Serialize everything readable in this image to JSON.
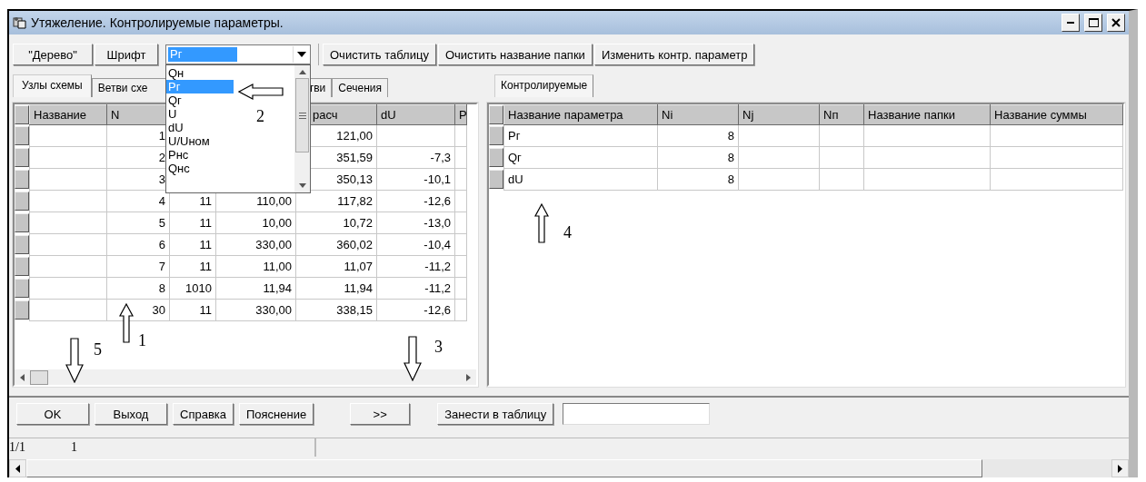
{
  "window": {
    "title": "Утяжеление. Контролируемые параметры."
  },
  "toolbar": {
    "buttons_left": [
      "\"Дерево\"",
      "Шрифт"
    ],
    "combo": {
      "value": "Рг",
      "expanded": true,
      "options": [
        {
          "label": "Qн",
          "selected": false
        },
        {
          "label": "Рг",
          "selected": true
        },
        {
          "label": "Qг",
          "selected": false
        },
        {
          "label": "U",
          "selected": false
        },
        {
          "label": "dU",
          "selected": false
        },
        {
          "label": "U/Uном",
          "selected": false
        },
        {
          "label": "Рнс",
          "selected": false
        },
        {
          "label": "Qнс",
          "selected": false
        }
      ]
    },
    "buttons_right": [
      "Очистить таблицу",
      "Очистить название папки",
      "Изменить контр. параметр"
    ]
  },
  "left_tabs": [
    {
      "label": "Узлы схемы",
      "selected": true
    },
    {
      "label": "Ветви схе",
      "selected": false
    },
    {
      "label": "тви",
      "selected": false
    },
    {
      "label": "Сечения",
      "selected": false
    }
  ],
  "left_table": {
    "columns": [
      "Название",
      "N",
      null,
      null,
      "расч",
      "dU",
      "Р"
    ],
    "rows": [
      [
        "",
        "1",
        null,
        null,
        "121,00",
        "",
        ""
      ],
      [
        "",
        "2",
        null,
        null,
        "351,59",
        "-7,3",
        ""
      ],
      [
        "",
        "3",
        null,
        null,
        "350,13",
        "-10,1",
        ""
      ],
      [
        "",
        "4",
        "11",
        "110,00",
        "117,82",
        "-12,6",
        ""
      ],
      [
        "",
        "5",
        "11",
        "10,00",
        "10,72",
        "-13,0",
        ""
      ],
      [
        "",
        "6",
        "11",
        "330,00",
        "360,02",
        "-10,4",
        ""
      ],
      [
        "",
        "7",
        "11",
        "11,00",
        "11,07",
        "-11,2",
        ""
      ],
      [
        "",
        "8",
        "1010",
        "11,94",
        "11,94",
        "-11,2",
        ""
      ],
      [
        "",
        "30",
        "11",
        "330,00",
        "338,15",
        "-12,6",
        ""
      ]
    ]
  },
  "right_tabs": [
    {
      "label": "Контролируемые",
      "selected": true
    }
  ],
  "right_table": {
    "columns": [
      "Название параметра",
      "Ni",
      "Nj",
      "Nп",
      "Название папки",
      "Название суммы"
    ],
    "rows": [
      [
        "Рг",
        "8",
        "",
        "",
        "",
        ""
      ],
      [
        "Qг",
        "8",
        "",
        "",
        "",
        ""
      ],
      [
        "dU",
        "8",
        "",
        "",
        "",
        ""
      ]
    ]
  },
  "bottom_buttons": [
    "OK",
    "Выход",
    "Справка",
    "Пояснение",
    ">>",
    "Занести в таблицу"
  ],
  "status_bar": [
    "1/1",
    "1"
  ],
  "annotations": [
    {
      "label": "1",
      "kind": "up"
    },
    {
      "label": "2",
      "kind": "left"
    },
    {
      "label": "3",
      "kind": "down"
    },
    {
      "label": "4",
      "kind": "up"
    },
    {
      "label": "5",
      "kind": "down"
    }
  ]
}
